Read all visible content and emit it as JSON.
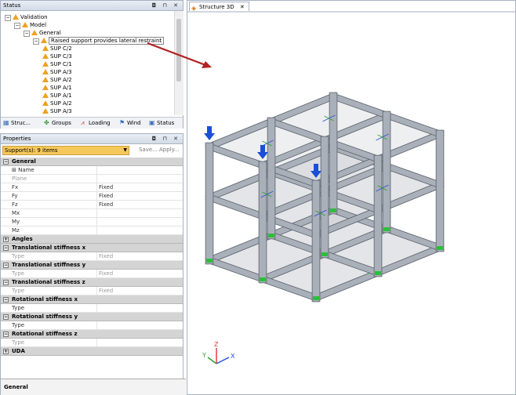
{
  "status_panel": {
    "title": "Status",
    "title_buttons": "◘ ⊓ ✕",
    "tree": [
      {
        "label": "Validation",
        "level": 0,
        "expander": "−"
      },
      {
        "label": "Model",
        "level": 1,
        "expander": "−"
      },
      {
        "label": "General",
        "level": 2,
        "expander": "−"
      },
      {
        "label": "Raised support provides lateral restraint",
        "level": 3,
        "expander": "−",
        "highlight": true
      },
      {
        "label": "SUP C/2",
        "level": 4
      },
      {
        "label": "SUP C/3",
        "level": 4
      },
      {
        "label": "SUP C/1",
        "level": 4
      },
      {
        "label": "SUP A/3",
        "level": 4
      },
      {
        "label": "SUP A/2",
        "level": 4
      },
      {
        "label": "SUP A/1",
        "level": 4
      },
      {
        "label": "SUP A/1",
        "level": 4
      },
      {
        "label": "SUP A/2",
        "level": 4
      },
      {
        "label": "SUP A/3",
        "level": 4
      }
    ],
    "tabs": [
      {
        "label": "Struc...",
        "icon": "structure-icon",
        "glyph": "▦",
        "color": "#3a6fc0"
      },
      {
        "label": "Groups",
        "icon": "groups-icon",
        "glyph": "✤",
        "color": "#3a9a3a"
      },
      {
        "label": "Loading",
        "icon": "loading-icon",
        "glyph": "⩘",
        "color": "#c03030"
      },
      {
        "label": "Wind",
        "icon": "wind-icon",
        "glyph": "⚑",
        "color": "#3a6fc0"
      },
      {
        "label": "Status",
        "icon": "status-icon",
        "glyph": "▣",
        "color": "#3a6fc0"
      }
    ]
  },
  "properties_panel": {
    "title": "Properties",
    "title_buttons": "◘ ⊓ ✕",
    "selection": "Support(s): 9 items",
    "save_label": "Save...",
    "apply_label": "Apply...",
    "rows": [
      {
        "kind": "head",
        "label": "General",
        "pm": "−"
      },
      {
        "kind": "row",
        "key": "⊞ Name",
        "value": ""
      },
      {
        "kind": "row",
        "key": "Plane",
        "value": "",
        "dim": true
      },
      {
        "kind": "row",
        "key": "Fx",
        "value": "Fixed"
      },
      {
        "kind": "row",
        "key": "Fy",
        "value": "Fixed"
      },
      {
        "kind": "row",
        "key": "Fz",
        "value": "Fixed"
      },
      {
        "kind": "row",
        "key": "Mx",
        "value": ""
      },
      {
        "kind": "row",
        "key": "My",
        "value": ""
      },
      {
        "kind": "row",
        "key": "Mz",
        "value": ""
      },
      {
        "kind": "head",
        "label": "Angles",
        "pm": "+"
      },
      {
        "kind": "head",
        "label": "Translational stiffness x",
        "pm": "−"
      },
      {
        "kind": "row",
        "key": "Type",
        "value": "Fixed",
        "dim": true
      },
      {
        "kind": "head",
        "label": "Translational stiffness y",
        "pm": "−"
      },
      {
        "kind": "row",
        "key": "Type",
        "value": "Fixed",
        "dim": true
      },
      {
        "kind": "head",
        "label": "Translational stiffness z",
        "pm": "−"
      },
      {
        "kind": "row",
        "key": "Type",
        "value": "Fixed",
        "dim": true
      },
      {
        "kind": "head",
        "label": "Rotational stiffness x",
        "pm": "−"
      },
      {
        "kind": "row",
        "key": "Type",
        "value": ""
      },
      {
        "kind": "head",
        "label": "Rotational stiffness y",
        "pm": "−"
      },
      {
        "kind": "row",
        "key": "Type",
        "value": ""
      },
      {
        "kind": "head",
        "label": "Rotational stiffness z",
        "pm": "−"
      },
      {
        "kind": "row",
        "key": "Type",
        "value": "",
        "dim": true
      },
      {
        "kind": "head",
        "label": "UDA",
        "pm": "+"
      }
    ],
    "description_title": "General"
  },
  "view": {
    "tab_label": "Structure 3D",
    "tab_close": "✕",
    "axis_labels": {
      "x": "X",
      "y": "Y",
      "z": "Z"
    }
  },
  "colors": {
    "accent_arrow": "#b22222",
    "load_arrow": "#1a4fd6",
    "warning": "#f0a020",
    "support": "#2bbf3b"
  }
}
